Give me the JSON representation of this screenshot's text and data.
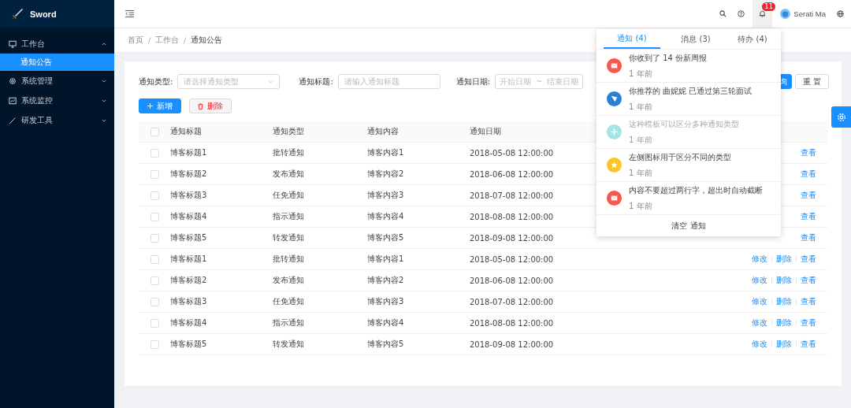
{
  "logo": {
    "title": "Sword"
  },
  "sidebar": {
    "items": [
      {
        "label": "工作台",
        "kind": "monitor",
        "expanded": true,
        "children": [
          {
            "label": "通知公告",
            "selected": true
          }
        ]
      },
      {
        "label": "系统管理",
        "kind": "gear",
        "expanded": false
      },
      {
        "label": "系统监控",
        "kind": "chart",
        "expanded": false
      },
      {
        "label": "研发工具",
        "kind": "tool",
        "expanded": false
      }
    ]
  },
  "header": {
    "notification_count": "11",
    "user": "Serati Ma"
  },
  "breadcrumb": [
    "首页",
    "工作台",
    "通知公告"
  ],
  "filters": [
    {
      "label": "通知类型:",
      "placeholder": "请选择通知类型",
      "kind": "select"
    },
    {
      "label": "通知标题:",
      "placeholder": "请输入通知标题",
      "kind": "input"
    },
    {
      "label": "通知日期:",
      "kind": "range",
      "start": "开始日期",
      "separator": "~",
      "end": "结束日期"
    }
  ],
  "filter_buttons": [
    {
      "label": "询",
      "kind": "primary"
    },
    {
      "label": "重 置",
      "kind": "default"
    }
  ],
  "actions": [
    {
      "label": "新增",
      "kind": "primary"
    },
    {
      "label": "删除",
      "kind": "danger"
    }
  ],
  "table": {
    "header_checked": false,
    "columns": [
      "通知标题",
      "通知类型",
      "通知内容",
      "通知日期"
    ],
    "rows": [
      {
        "checked": false,
        "cells": [
          "博客标题1",
          "批转通知",
          "博客内容1",
          "2018-05-08 12:00:00"
        ],
        "actions": [
          "查看"
        ]
      },
      {
        "checked": false,
        "cells": [
          "博客标题2",
          "发布通知",
          "博客内容2",
          "2018-06-08 12:00:00"
        ],
        "actions": [
          "查看"
        ]
      },
      {
        "checked": false,
        "cells": [
          "博客标题3",
          "任免通知",
          "博客内容3",
          "2018-07-08 12:00:00"
        ],
        "actions": [
          "查看"
        ]
      },
      {
        "checked": false,
        "cells": [
          "博客标题4",
          "指示通知",
          "博客内容4",
          "2018-08-08 12:00:00"
        ],
        "actions": [
          "查看"
        ]
      },
      {
        "checked": false,
        "cells": [
          "博客标题5",
          "转发通知",
          "博客内容5",
          "2018-09-08 12:00:00"
        ],
        "actions": [
          "查看"
        ]
      },
      {
        "checked": false,
        "cells": [
          "博客标题1",
          "批转通知",
          "博客内容1",
          "2018-05-08 12:00:00"
        ],
        "actions": [
          "修改",
          "删除",
          "查看"
        ]
      },
      {
        "checked": false,
        "cells": [
          "博客标题2",
          "发布通知",
          "博客内容2",
          "2018-06-08 12:00:00"
        ],
        "actions": [
          "修改",
          "删除",
          "查看"
        ]
      },
      {
        "checked": false,
        "cells": [
          "博客标题3",
          "任免通知",
          "博客内容3",
          "2018-07-08 12:00:00"
        ],
        "actions": [
          "修改",
          "删除",
          "查看"
        ]
      },
      {
        "checked": false,
        "cells": [
          "博客标题4",
          "指示通知",
          "博客内容4",
          "2018-08-08 12:00:00"
        ],
        "actions": [
          "修改",
          "删除",
          "查看"
        ]
      },
      {
        "checked": false,
        "cells": [
          "博客标题5",
          "转发通知",
          "博客内容5",
          "2018-09-08 12:00:00"
        ],
        "actions": [
          "修改",
          "删除",
          "查看"
        ]
      }
    ]
  },
  "notice_popup": {
    "tabs": [
      {
        "label": "通知 (4)",
        "selected": true
      },
      {
        "label": "消息 (3)",
        "selected": false
      },
      {
        "label": "待办 (4)",
        "selected": false
      }
    ],
    "items": [
      {
        "kind": "mail",
        "color": "#f5584f",
        "text": "你收到了 14 份新周报",
        "time": "1 年前",
        "disabled": false
      },
      {
        "kind": "plane",
        "color": "#2a7fd8",
        "text": "你推荐的 曲妮妮 已通过第三轮面试",
        "time": "1 年前",
        "disabled": false
      },
      {
        "kind": "plus",
        "color": "#a8e3e3",
        "text": "这种模板可以区分多种通知类型",
        "time": "1 年前",
        "disabled": true
      },
      {
        "kind": "star",
        "color": "#fcc52c",
        "text": "左侧图标用于区分不同的类型",
        "time": "1 年前",
        "disabled": false
      },
      {
        "kind": "mail",
        "color": "#f5584f",
        "text": "内容不要超过两行字，超出时自动截断",
        "time": "1 年前",
        "disabled": false
      }
    ],
    "footer": "清空 通知"
  }
}
